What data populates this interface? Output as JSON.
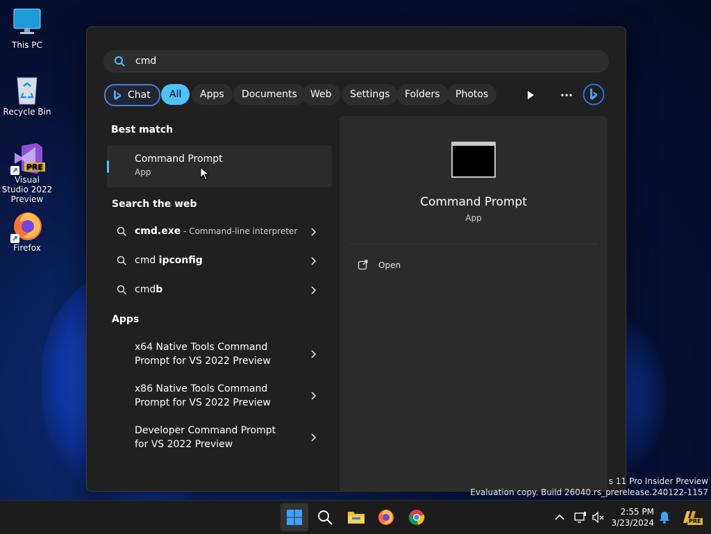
{
  "desktop": {
    "icons": [
      {
        "label": "This PC"
      },
      {
        "label": "Recycle Bin"
      },
      {
        "label": "Visual Studio 2022 Preview",
        "badge": "PRE"
      },
      {
        "label": "Firefox"
      }
    ]
  },
  "search": {
    "query": "cmd"
  },
  "filters": [
    {
      "label": "Chat"
    },
    {
      "label": "All"
    },
    {
      "label": "Apps"
    },
    {
      "label": "Documents"
    },
    {
      "label": "Web"
    },
    {
      "label": "Settings"
    },
    {
      "label": "Folders"
    },
    {
      "label": "Photos"
    }
  ],
  "best_match": {
    "heading": "Best match",
    "name": "Command Prompt",
    "type": "App"
  },
  "web": {
    "heading": "Search the web",
    "items": [
      {
        "bold": "cmd.exe",
        "rest": " - Command-line interpreter"
      },
      {
        "plain": "cmd ",
        "bold": "ipconfig"
      },
      {
        "plain": "cmd",
        "bold": "b"
      }
    ]
  },
  "apps": {
    "heading": "Apps",
    "items": [
      {
        "label": "x64 Native Tools Command Prompt for VS 2022 Preview"
      },
      {
        "label": "x86 Native Tools Command Prompt for VS 2022 Preview"
      },
      {
        "label": "Developer Command Prompt for VS 2022 Preview"
      }
    ]
  },
  "detail": {
    "title": "Command Prompt",
    "subtitle": "App",
    "actions": [
      {
        "label": "Open",
        "icon": "open-external-icon"
      }
    ]
  },
  "watermark": {
    "line1": "s 11 Pro Insider Preview",
    "line2": "Evaluation copy. Build 26040.rs_prerelease.240122-1157"
  },
  "clock": {
    "time": "2:55 PM",
    "date": "3/23/2024"
  },
  "tray_badge": "PRE",
  "colors": {
    "accent": "#4cc2ff",
    "panel": "#202020",
    "pane": "#2b2b2b"
  }
}
